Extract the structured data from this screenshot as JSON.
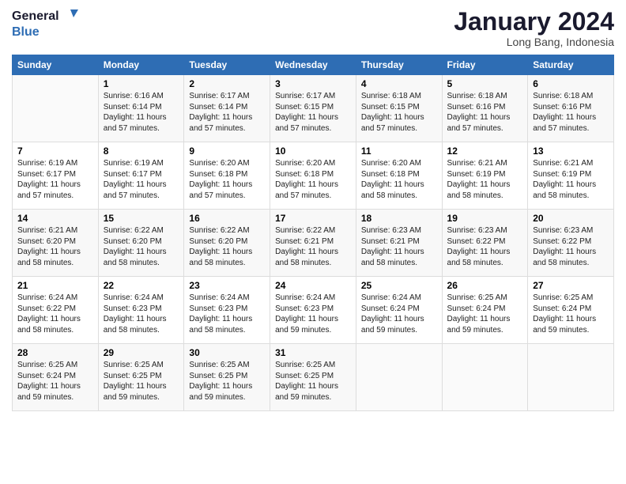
{
  "header": {
    "logo_line1": "General",
    "logo_line2": "Blue",
    "month_title": "January 2024",
    "location": "Long Bang, Indonesia"
  },
  "weekdays": [
    "Sunday",
    "Monday",
    "Tuesday",
    "Wednesday",
    "Thursday",
    "Friday",
    "Saturday"
  ],
  "weeks": [
    [
      {
        "day": "",
        "content": ""
      },
      {
        "day": "1",
        "content": "Sunrise: 6:16 AM\nSunset: 6:14 PM\nDaylight: 11 hours\nand 57 minutes."
      },
      {
        "day": "2",
        "content": "Sunrise: 6:17 AM\nSunset: 6:14 PM\nDaylight: 11 hours\nand 57 minutes."
      },
      {
        "day": "3",
        "content": "Sunrise: 6:17 AM\nSunset: 6:15 PM\nDaylight: 11 hours\nand 57 minutes."
      },
      {
        "day": "4",
        "content": "Sunrise: 6:18 AM\nSunset: 6:15 PM\nDaylight: 11 hours\nand 57 minutes."
      },
      {
        "day": "5",
        "content": "Sunrise: 6:18 AM\nSunset: 6:16 PM\nDaylight: 11 hours\nand 57 minutes."
      },
      {
        "day": "6",
        "content": "Sunrise: 6:18 AM\nSunset: 6:16 PM\nDaylight: 11 hours\nand 57 minutes."
      }
    ],
    [
      {
        "day": "7",
        "content": "Sunrise: 6:19 AM\nSunset: 6:17 PM\nDaylight: 11 hours\nand 57 minutes."
      },
      {
        "day": "8",
        "content": "Sunrise: 6:19 AM\nSunset: 6:17 PM\nDaylight: 11 hours\nand 57 minutes."
      },
      {
        "day": "9",
        "content": "Sunrise: 6:20 AM\nSunset: 6:18 PM\nDaylight: 11 hours\nand 57 minutes."
      },
      {
        "day": "10",
        "content": "Sunrise: 6:20 AM\nSunset: 6:18 PM\nDaylight: 11 hours\nand 57 minutes."
      },
      {
        "day": "11",
        "content": "Sunrise: 6:20 AM\nSunset: 6:18 PM\nDaylight: 11 hours\nand 58 minutes."
      },
      {
        "day": "12",
        "content": "Sunrise: 6:21 AM\nSunset: 6:19 PM\nDaylight: 11 hours\nand 58 minutes."
      },
      {
        "day": "13",
        "content": "Sunrise: 6:21 AM\nSunset: 6:19 PM\nDaylight: 11 hours\nand 58 minutes."
      }
    ],
    [
      {
        "day": "14",
        "content": "Sunrise: 6:21 AM\nSunset: 6:20 PM\nDaylight: 11 hours\nand 58 minutes."
      },
      {
        "day": "15",
        "content": "Sunrise: 6:22 AM\nSunset: 6:20 PM\nDaylight: 11 hours\nand 58 minutes."
      },
      {
        "day": "16",
        "content": "Sunrise: 6:22 AM\nSunset: 6:20 PM\nDaylight: 11 hours\nand 58 minutes."
      },
      {
        "day": "17",
        "content": "Sunrise: 6:22 AM\nSunset: 6:21 PM\nDaylight: 11 hours\nand 58 minutes."
      },
      {
        "day": "18",
        "content": "Sunrise: 6:23 AM\nSunset: 6:21 PM\nDaylight: 11 hours\nand 58 minutes."
      },
      {
        "day": "19",
        "content": "Sunrise: 6:23 AM\nSunset: 6:22 PM\nDaylight: 11 hours\nand 58 minutes."
      },
      {
        "day": "20",
        "content": "Sunrise: 6:23 AM\nSunset: 6:22 PM\nDaylight: 11 hours\nand 58 minutes."
      }
    ],
    [
      {
        "day": "21",
        "content": "Sunrise: 6:24 AM\nSunset: 6:22 PM\nDaylight: 11 hours\nand 58 minutes."
      },
      {
        "day": "22",
        "content": "Sunrise: 6:24 AM\nSunset: 6:23 PM\nDaylight: 11 hours\nand 58 minutes."
      },
      {
        "day": "23",
        "content": "Sunrise: 6:24 AM\nSunset: 6:23 PM\nDaylight: 11 hours\nand 58 minutes."
      },
      {
        "day": "24",
        "content": "Sunrise: 6:24 AM\nSunset: 6:23 PM\nDaylight: 11 hours\nand 59 minutes."
      },
      {
        "day": "25",
        "content": "Sunrise: 6:24 AM\nSunset: 6:24 PM\nDaylight: 11 hours\nand 59 minutes."
      },
      {
        "day": "26",
        "content": "Sunrise: 6:25 AM\nSunset: 6:24 PM\nDaylight: 11 hours\nand 59 minutes."
      },
      {
        "day": "27",
        "content": "Sunrise: 6:25 AM\nSunset: 6:24 PM\nDaylight: 11 hours\nand 59 minutes."
      }
    ],
    [
      {
        "day": "28",
        "content": "Sunrise: 6:25 AM\nSunset: 6:24 PM\nDaylight: 11 hours\nand 59 minutes."
      },
      {
        "day": "29",
        "content": "Sunrise: 6:25 AM\nSunset: 6:25 PM\nDaylight: 11 hours\nand 59 minutes."
      },
      {
        "day": "30",
        "content": "Sunrise: 6:25 AM\nSunset: 6:25 PM\nDaylight: 11 hours\nand 59 minutes."
      },
      {
        "day": "31",
        "content": "Sunrise: 6:25 AM\nSunset: 6:25 PM\nDaylight: 11 hours\nand 59 minutes."
      },
      {
        "day": "",
        "content": ""
      },
      {
        "day": "",
        "content": ""
      },
      {
        "day": "",
        "content": ""
      }
    ]
  ]
}
